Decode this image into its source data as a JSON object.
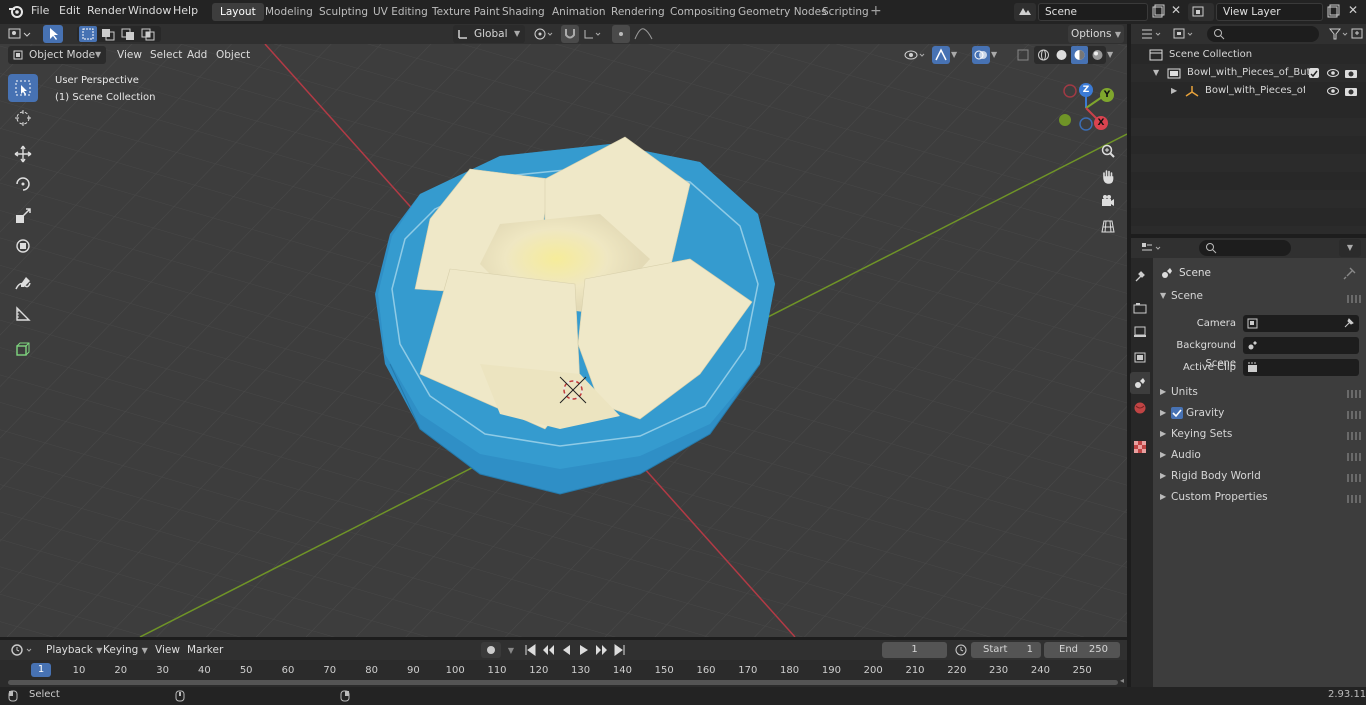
{
  "menu": {
    "file": "File",
    "edit": "Edit",
    "render": "Render",
    "window": "Window",
    "help": "Help"
  },
  "workspaces": [
    "Layout",
    "Modeling",
    "Sculpting",
    "UV Editing",
    "Texture Paint",
    "Shading",
    "Animation",
    "Rendering",
    "Compositing",
    "Geometry Nodes",
    "Scripting"
  ],
  "active_workspace": "Layout",
  "scene_field": "Scene",
  "view_layer_field": "View Layer",
  "viewport": {
    "mode": "Object Mode",
    "menus": {
      "view": "View",
      "select": "Select",
      "add": "Add",
      "object": "Object"
    },
    "transform_orientation": "Global",
    "options": "Options",
    "overlay_line1": "User Perspective",
    "overlay_line2": "(1) Scene Collection"
  },
  "gizmo": {
    "z": "Z",
    "y": "Y",
    "x": "X"
  },
  "outliner": {
    "root": "Scene Collection",
    "items": [
      "Bowl_with_Pieces_of_Butter_(",
      "Bowl_with_Pieces_of_Bu"
    ]
  },
  "properties": {
    "context": "Scene",
    "panel_title": "Scene",
    "camera_label": "Camera",
    "background_scene_label": "Background Scene",
    "active_clip_label": "Active Clip",
    "gravity_checked": true,
    "sections": [
      "Units",
      "Gravity",
      "Keying Sets",
      "Audio",
      "Rigid Body World",
      "Custom Properties"
    ]
  },
  "timeline": {
    "menus": {
      "playback": "Playback",
      "keying": "Keying",
      "view": "View",
      "marker": "Marker"
    },
    "current_frame": "1",
    "start_label": "Start",
    "start_value": "1",
    "end_label": "End",
    "end_value": "250",
    "ruler": [
      "10",
      "20",
      "30",
      "40",
      "50",
      "60",
      "70",
      "80",
      "90",
      "100",
      "110",
      "120",
      "130",
      "140",
      "150",
      "160",
      "170",
      "180",
      "190",
      "200",
      "210",
      "220",
      "230",
      "240",
      "250"
    ],
    "playhead": "1"
  },
  "statusbar": {
    "select": "Select",
    "version": "2.93.11"
  },
  "colors": {
    "accent": "#4772b3",
    "x_axis": "#c9414a",
    "y_axis": "#7fa62d",
    "bowl": "#2e8fc5",
    "butter": "#ede6c5"
  }
}
